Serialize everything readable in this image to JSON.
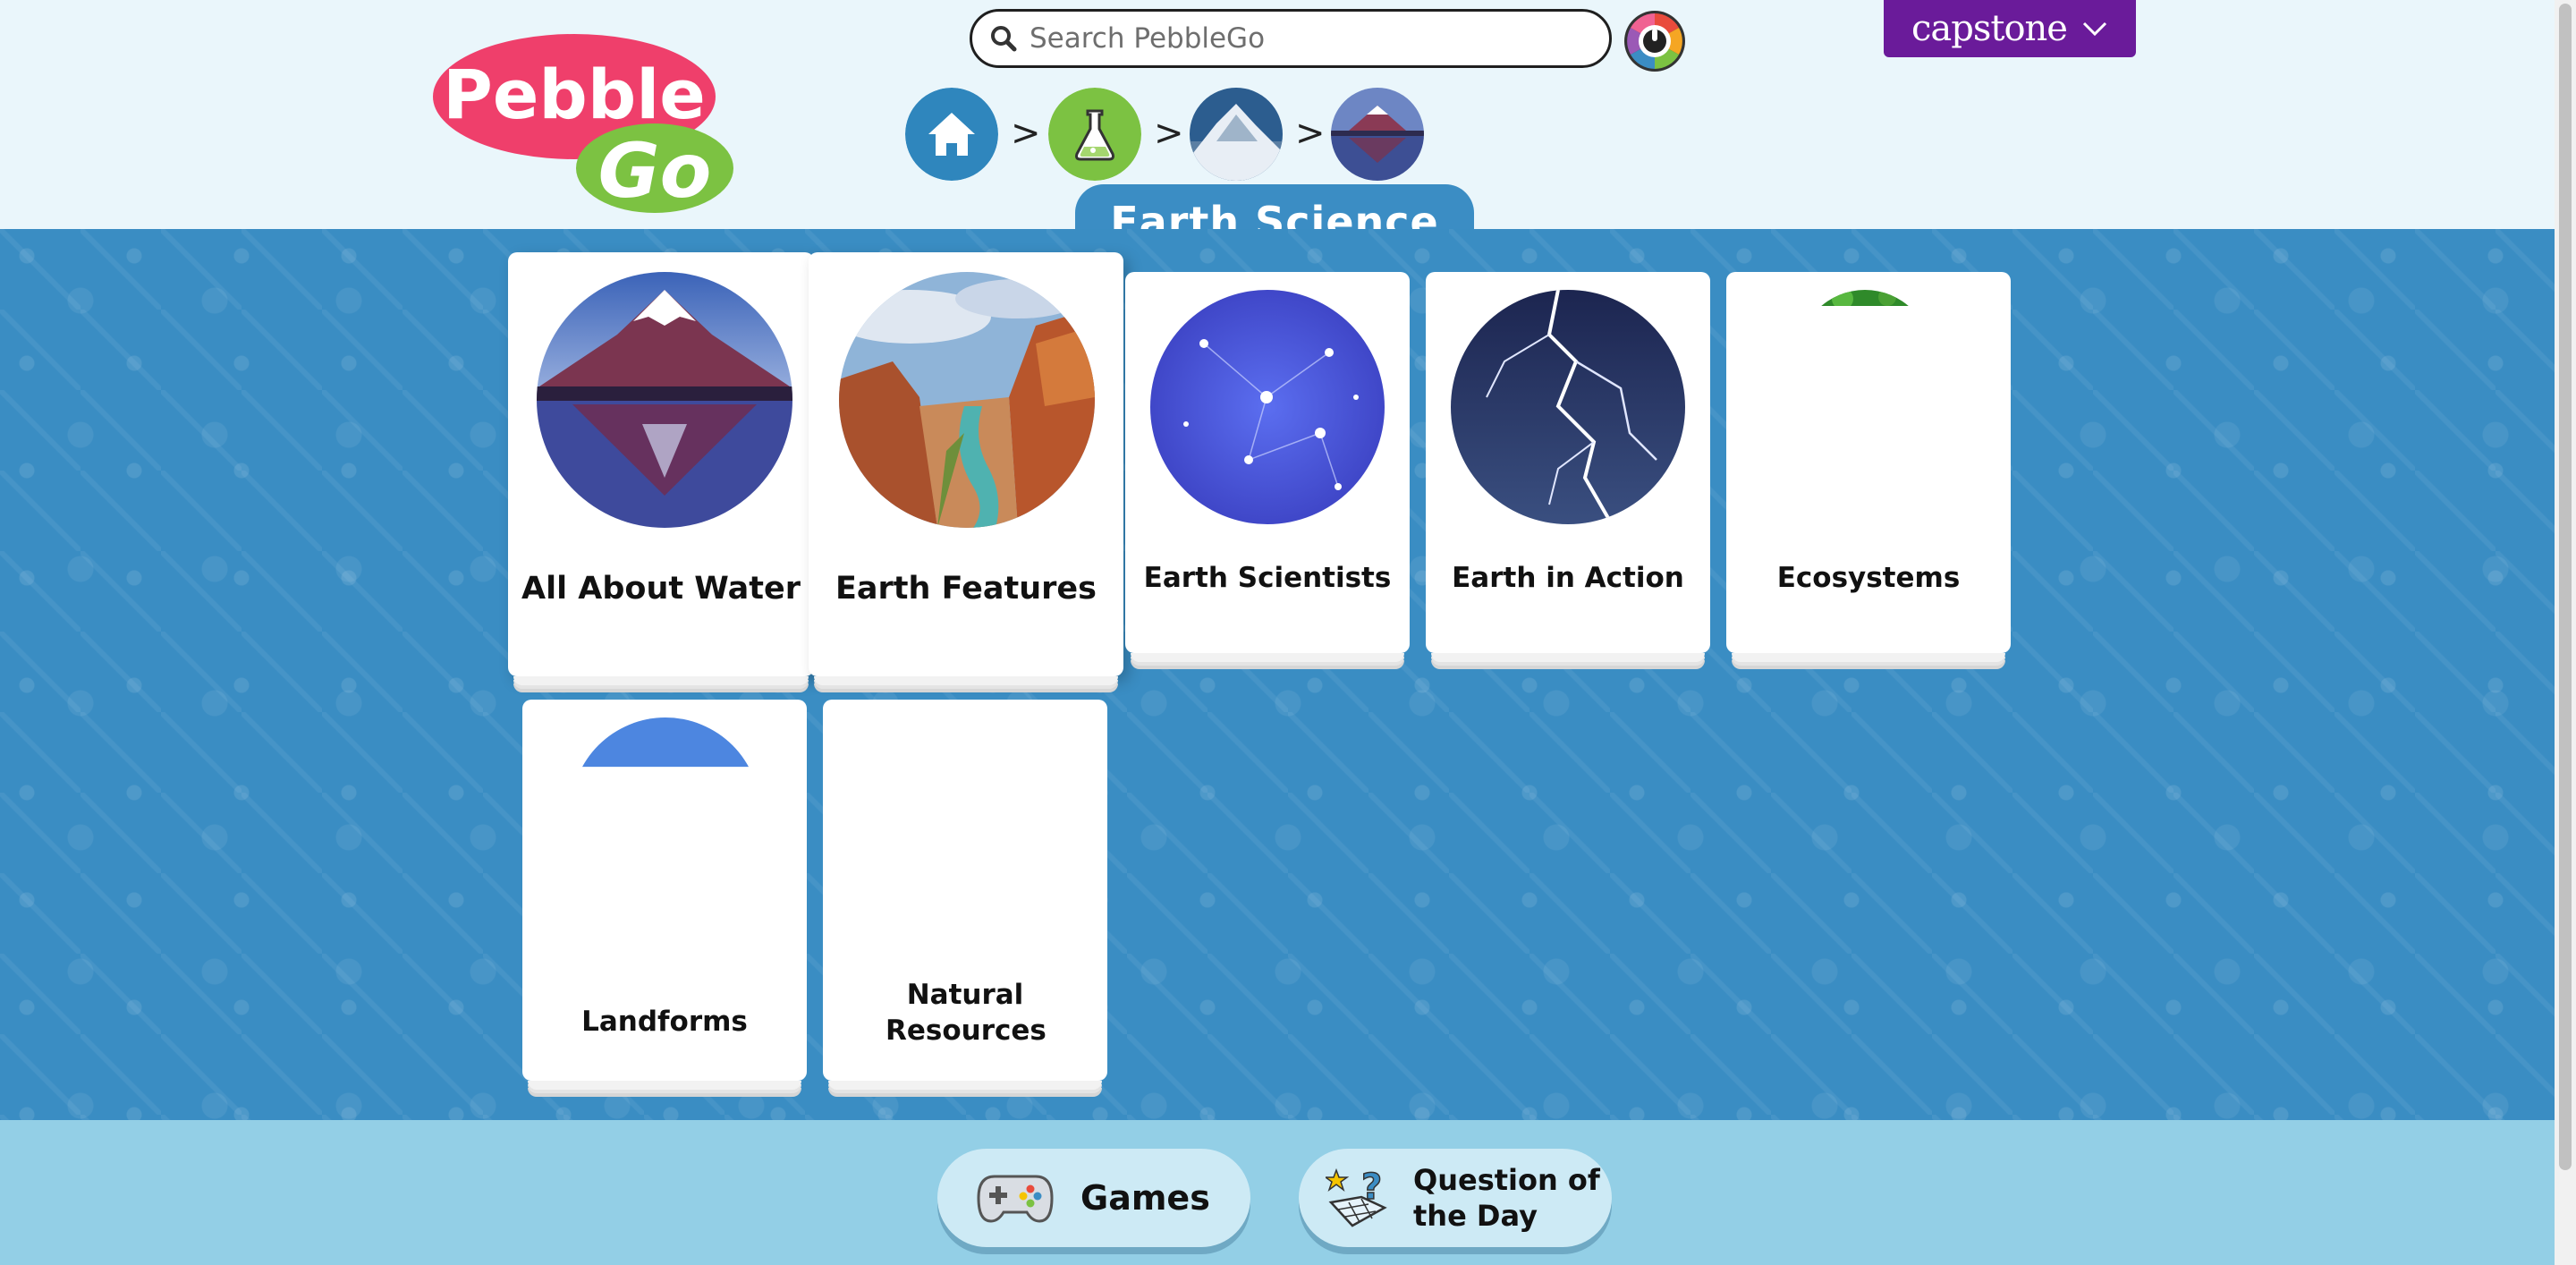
{
  "header": {
    "logo_top": "Pebble",
    "logo_bottom": "Go",
    "search_placeholder": "Search PebbleGo",
    "publisher_label": "capstone",
    "breadcrumb_separator": ">",
    "section_title": "Earth Science"
  },
  "topics": [
    {
      "label": "All About Water"
    },
    {
      "label": "Earth Features"
    },
    {
      "label": "Earth Scientists"
    },
    {
      "label": "Earth in Action"
    },
    {
      "label": "Ecosystems"
    },
    {
      "label": "Landforms"
    },
    {
      "label": "Natural Resources"
    }
  ],
  "footer": {
    "games_label": "Games",
    "qotd_label_line1": "Question of",
    "qotd_label_line2": "the Day"
  },
  "colors": {
    "panel_blue": "#3a8dc3",
    "logo_pink": "#ef3f6b",
    "logo_green": "#7cc242",
    "capstone_purple": "#6a1b9a",
    "footer_blue": "#93cfe6"
  }
}
